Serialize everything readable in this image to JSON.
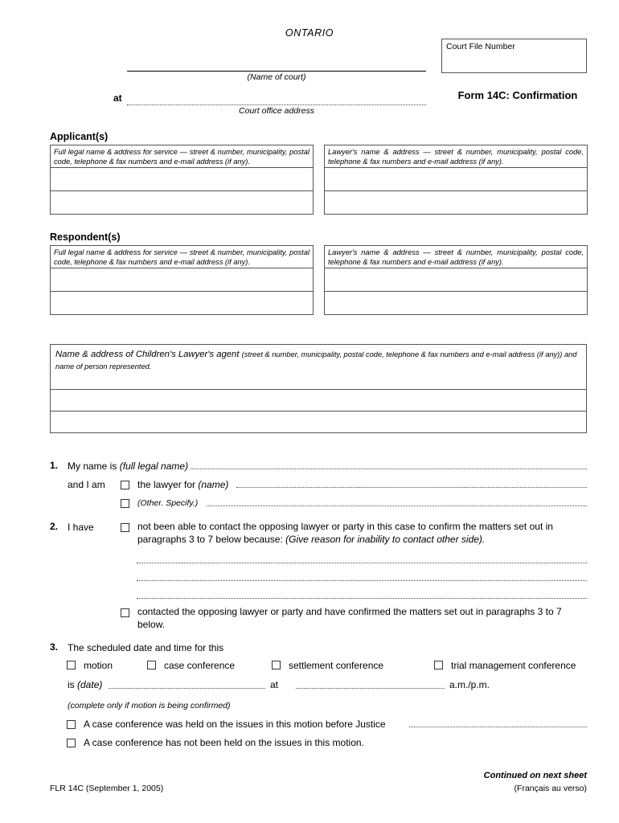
{
  "header": {
    "jurisdiction": "ONTARIO",
    "court_file_number_label": "Court File Number",
    "name_of_court_caption": "(Name of court)",
    "at_label": "at",
    "court_office_address_caption": "Court office address",
    "form_title": "Form 14C:  Confirmation"
  },
  "parties": {
    "applicant_heading": "Applicant(s)",
    "respondent_heading": "Respondent(s)",
    "party_note": "Full legal name & address for service — street & number, municipality, postal code, telephone & fax numbers and e-mail address (if any).",
    "lawyer_note": "Lawyer's name & address — street & number, municipality, postal code, telephone & fax numbers and e-mail address (if any)."
  },
  "childrens_lawyer": {
    "lead": "Name & address of Children's Lawyer's agent",
    "detail": "(street & number, municipality, postal code, telephone & fax numbers and e-mail address (if any)) and name of person represented."
  },
  "paragraph1": {
    "number": "1.",
    "lead": "My name is",
    "lead_hint": "(full legal name)",
    "and_i_am": "and I am",
    "option_lawyer": "the lawyer for",
    "option_lawyer_hint": "(name)",
    "option_other": "(Other. Specify.)"
  },
  "paragraph2": {
    "number": "2.",
    "lead": "I have",
    "option_not_contacted": "not been able to contact the opposing lawyer or party in this case to confirm the matters set out in paragraphs 3 to 7 below because:",
    "option_not_contacted_hint": "(Give reason for inability to contact other side).",
    "option_contacted": "contacted the opposing lawyer or party and have confirmed the matters set out in paragraphs 3 to 7 below."
  },
  "paragraph3": {
    "number": "3.",
    "lead": "The scheduled date and time for this",
    "event_options": [
      "motion",
      "case conference",
      "settlement conference",
      "trial management conference"
    ],
    "is_label": "is",
    "date_hint": "(date)",
    "at_label": "at",
    "ampm_label": "a.m./p.m.",
    "motion_only_note": "(complete only if motion is being confirmed)",
    "conference_held": "A case conference was held on the issues in this motion before Justice",
    "conference_not_held": "A case conference has not been held on the issues in this motion."
  },
  "footer": {
    "form_code": "FLR 14C (September 1, 2005)",
    "continued": "Continued on next sheet",
    "francais": "(Français au verso)"
  }
}
